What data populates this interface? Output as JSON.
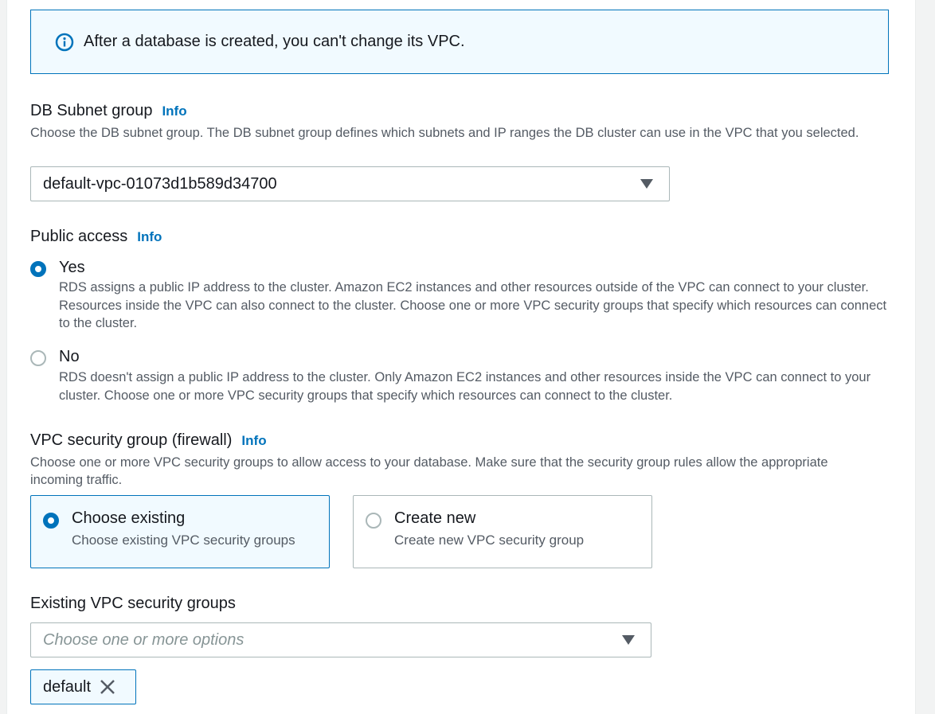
{
  "alert": {
    "icon": "info-circle-icon",
    "text": "After a database is created, you can't change its VPC."
  },
  "subnet_group": {
    "label": "DB Subnet group",
    "info": "Info",
    "description": "Choose the DB subnet group. The DB subnet group defines which subnets and IP ranges the DB cluster can use in the VPC that you selected.",
    "selected_value": "default-vpc-01073d1b589d34700"
  },
  "public_access": {
    "label": "Public access",
    "info": "Info",
    "options": [
      {
        "title": "Yes",
        "checked": true,
        "description": "RDS assigns a public IP address to the cluster. Amazon EC2 instances and other resources outside of the VPC can connect to your cluster. Resources inside the VPC can also connect to the cluster. Choose one or more VPC security groups that specify which resources can connect to the cluster."
      },
      {
        "title": "No",
        "checked": false,
        "description": "RDS doesn't assign a public IP address to the cluster. Only Amazon EC2 instances and other resources inside the VPC can connect to your cluster. Choose one or more VPC security groups that specify which resources can connect to the cluster."
      }
    ]
  },
  "vpc_security_group": {
    "label": "VPC security group (firewall)",
    "info": "Info",
    "description": "Choose one or more VPC security groups to allow access to your database. Make sure that the security group rules allow the appropriate incoming traffic.",
    "tiles": [
      {
        "title": "Choose existing",
        "description": "Choose existing VPC security groups",
        "selected": true
      },
      {
        "title": "Create new",
        "description": "Create new VPC security group",
        "selected": false
      }
    ]
  },
  "existing_groups": {
    "label": "Existing VPC security groups",
    "placeholder": "Choose one or more options",
    "tokens": [
      {
        "label": "default"
      }
    ]
  },
  "colors": {
    "accent": "#0073bb",
    "text": "#16191f",
    "secondary_text": "#545b64",
    "border": "#aab7b8",
    "alert_bg": "#f1faff"
  }
}
